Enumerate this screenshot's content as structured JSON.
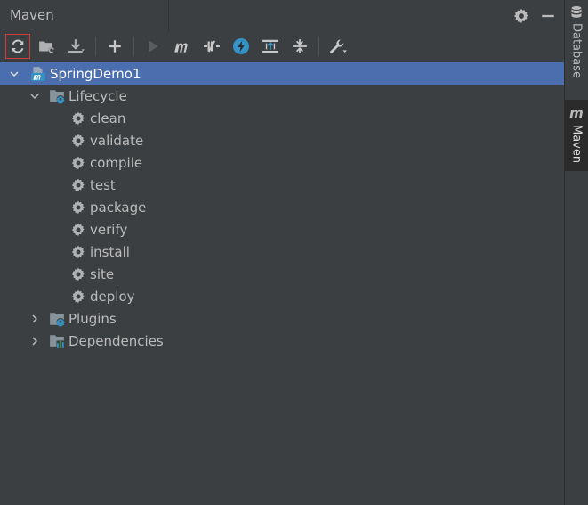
{
  "panel": {
    "title": "Maven"
  },
  "toolbar": {
    "buttons": [
      {
        "name": "reload-all-maven-projects",
        "icon": "refresh-icon"
      },
      {
        "name": "generate-sources",
        "icon": "folder-refresh-icon"
      },
      {
        "name": "download-sources",
        "icon": "download-icon"
      },
      {
        "name": "add-maven-project",
        "icon": "plus-icon"
      },
      {
        "name": "run-maven-build",
        "icon": "run-icon"
      },
      {
        "name": "execute-maven-goal",
        "icon": "maven-m-icon"
      },
      {
        "name": "toggle-offline-mode",
        "icon": "offline-icon"
      },
      {
        "name": "skip-tests",
        "icon": "lightning-icon"
      },
      {
        "name": "show-dependencies",
        "icon": "dependencies-diagram-icon"
      },
      {
        "name": "collapse-all",
        "icon": "collapse-icon"
      },
      {
        "name": "maven-settings",
        "icon": "wrench-icon"
      }
    ]
  },
  "tree": {
    "root": "SpringDemo1",
    "lifecycle": "Lifecycle",
    "goals": [
      "clean",
      "validate",
      "compile",
      "test",
      "package",
      "verify",
      "install",
      "site",
      "deploy"
    ],
    "plugins": "Plugins",
    "dependencies": "Dependencies"
  },
  "sidebar": {
    "database": "Database",
    "maven": "Maven",
    "maven_logo": "m"
  },
  "colors": {
    "background": "#3c3f41",
    "selection": "#4b6eaf",
    "text": "#bbbbbb",
    "highlight_border": "#d23c3c",
    "accent_blue": "#3592c4"
  }
}
